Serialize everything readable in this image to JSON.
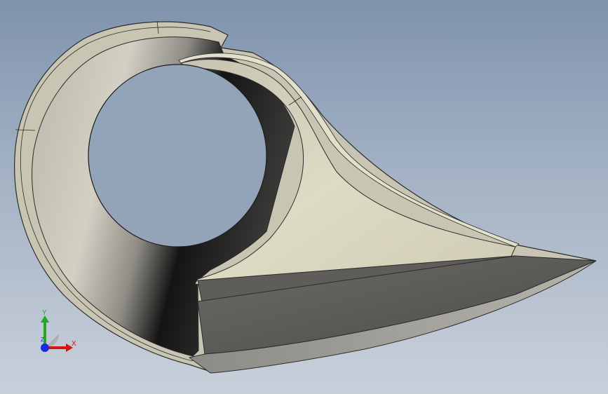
{
  "view": {
    "background_top": "#7f93ad",
    "background_bottom": "#c9d0da",
    "part_color": "#d9d5c0"
  },
  "triad": {
    "x_label": "X",
    "y_label": "Y",
    "z_label": "Z",
    "x_color": "#d01616",
    "y_color": "#1faa1f",
    "z_color": "#1a2ce0"
  }
}
